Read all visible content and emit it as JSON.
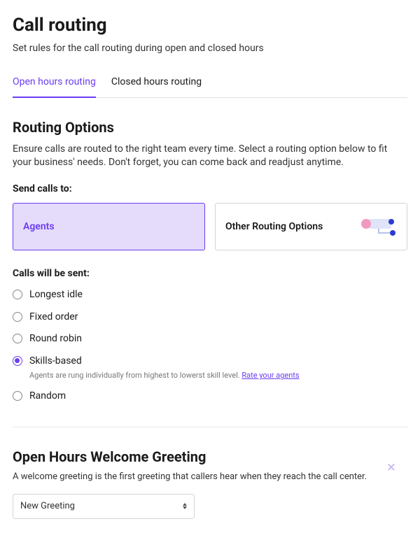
{
  "header": {
    "title": "Call routing",
    "subtitle": "Set rules for the call routing during open and closed hours"
  },
  "tabs": [
    {
      "label": "Open hours routing",
      "active": true
    },
    {
      "label": "Closed hours routing",
      "active": false
    }
  ],
  "routing": {
    "title": "Routing Options",
    "desc": "Ensure calls are routed to the right team every time. Select a routing option below to fit your business' needs. Don't forget, you can come back and readjust anytime.",
    "send_label": "Send calls to:",
    "cards": [
      {
        "label": "Agents",
        "selected": true
      },
      {
        "label": "Other Routing Options",
        "selected": false,
        "has_icon": true
      }
    ],
    "calls_sent_label": "Calls will be sent:",
    "options": [
      {
        "label": "Longest idle",
        "selected": false
      },
      {
        "label": "Fixed order",
        "selected": false
      },
      {
        "label": "Round robin",
        "selected": false
      },
      {
        "label": "Skills-based",
        "selected": true,
        "hint_text": "Agents are rung individually from highest to lowerst skill level.",
        "hint_link": "Rate your agents"
      },
      {
        "label": "Random",
        "selected": false
      }
    ]
  },
  "greeting": {
    "title": "Open Hours Welcome Greeting",
    "desc": "A welcome greeting is the first greeting that callers hear when they reach the call center.",
    "select_value": "New Greeting"
  }
}
